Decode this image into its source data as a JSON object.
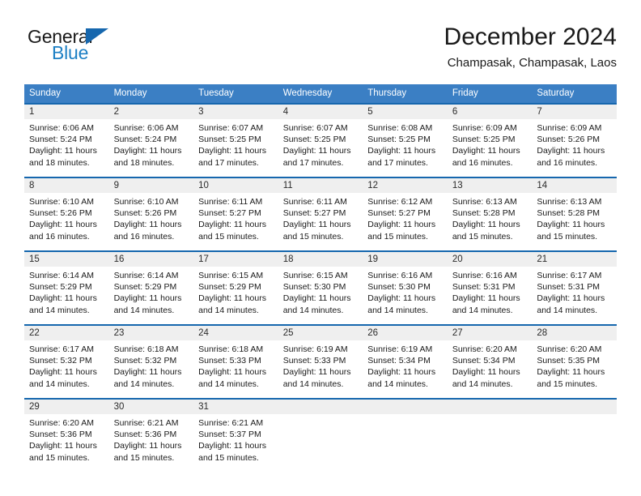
{
  "brand": {
    "name_part1": "General",
    "name_part2": "Blue",
    "triangle_color": "#1667ae",
    "blue_color": "#1c7fc4"
  },
  "header": {
    "month_title": "December 2024",
    "location": "Champasak, Champasak, Laos"
  },
  "theme": {
    "header_blue": "#3b7fc4",
    "row_border_blue": "#1667ae",
    "daynum_band": "#efefef"
  },
  "weekday_headers": [
    "Sunday",
    "Monday",
    "Tuesday",
    "Wednesday",
    "Thursday",
    "Friday",
    "Saturday"
  ],
  "weeks": [
    [
      {
        "day": "1",
        "sunrise": "Sunrise: 6:06 AM",
        "sunset": "Sunset: 5:24 PM",
        "daylight1": "Daylight: 11 hours",
        "daylight2": "and 18 minutes."
      },
      {
        "day": "2",
        "sunrise": "Sunrise: 6:06 AM",
        "sunset": "Sunset: 5:24 PM",
        "daylight1": "Daylight: 11 hours",
        "daylight2": "and 18 minutes."
      },
      {
        "day": "3",
        "sunrise": "Sunrise: 6:07 AM",
        "sunset": "Sunset: 5:25 PM",
        "daylight1": "Daylight: 11 hours",
        "daylight2": "and 17 minutes."
      },
      {
        "day": "4",
        "sunrise": "Sunrise: 6:07 AM",
        "sunset": "Sunset: 5:25 PM",
        "daylight1": "Daylight: 11 hours",
        "daylight2": "and 17 minutes."
      },
      {
        "day": "5",
        "sunrise": "Sunrise: 6:08 AM",
        "sunset": "Sunset: 5:25 PM",
        "daylight1": "Daylight: 11 hours",
        "daylight2": "and 17 minutes."
      },
      {
        "day": "6",
        "sunrise": "Sunrise: 6:09 AM",
        "sunset": "Sunset: 5:25 PM",
        "daylight1": "Daylight: 11 hours",
        "daylight2": "and 16 minutes."
      },
      {
        "day": "7",
        "sunrise": "Sunrise: 6:09 AM",
        "sunset": "Sunset: 5:26 PM",
        "daylight1": "Daylight: 11 hours",
        "daylight2": "and 16 minutes."
      }
    ],
    [
      {
        "day": "8",
        "sunrise": "Sunrise: 6:10 AM",
        "sunset": "Sunset: 5:26 PM",
        "daylight1": "Daylight: 11 hours",
        "daylight2": "and 16 minutes."
      },
      {
        "day": "9",
        "sunrise": "Sunrise: 6:10 AM",
        "sunset": "Sunset: 5:26 PM",
        "daylight1": "Daylight: 11 hours",
        "daylight2": "and 16 minutes."
      },
      {
        "day": "10",
        "sunrise": "Sunrise: 6:11 AM",
        "sunset": "Sunset: 5:27 PM",
        "daylight1": "Daylight: 11 hours",
        "daylight2": "and 15 minutes."
      },
      {
        "day": "11",
        "sunrise": "Sunrise: 6:11 AM",
        "sunset": "Sunset: 5:27 PM",
        "daylight1": "Daylight: 11 hours",
        "daylight2": "and 15 minutes."
      },
      {
        "day": "12",
        "sunrise": "Sunrise: 6:12 AM",
        "sunset": "Sunset: 5:27 PM",
        "daylight1": "Daylight: 11 hours",
        "daylight2": "and 15 minutes."
      },
      {
        "day": "13",
        "sunrise": "Sunrise: 6:13 AM",
        "sunset": "Sunset: 5:28 PM",
        "daylight1": "Daylight: 11 hours",
        "daylight2": "and 15 minutes."
      },
      {
        "day": "14",
        "sunrise": "Sunrise: 6:13 AM",
        "sunset": "Sunset: 5:28 PM",
        "daylight1": "Daylight: 11 hours",
        "daylight2": "and 15 minutes."
      }
    ],
    [
      {
        "day": "15",
        "sunrise": "Sunrise: 6:14 AM",
        "sunset": "Sunset: 5:29 PM",
        "daylight1": "Daylight: 11 hours",
        "daylight2": "and 14 minutes."
      },
      {
        "day": "16",
        "sunrise": "Sunrise: 6:14 AM",
        "sunset": "Sunset: 5:29 PM",
        "daylight1": "Daylight: 11 hours",
        "daylight2": "and 14 minutes."
      },
      {
        "day": "17",
        "sunrise": "Sunrise: 6:15 AM",
        "sunset": "Sunset: 5:29 PM",
        "daylight1": "Daylight: 11 hours",
        "daylight2": "and 14 minutes."
      },
      {
        "day": "18",
        "sunrise": "Sunrise: 6:15 AM",
        "sunset": "Sunset: 5:30 PM",
        "daylight1": "Daylight: 11 hours",
        "daylight2": "and 14 minutes."
      },
      {
        "day": "19",
        "sunrise": "Sunrise: 6:16 AM",
        "sunset": "Sunset: 5:30 PM",
        "daylight1": "Daylight: 11 hours",
        "daylight2": "and 14 minutes."
      },
      {
        "day": "20",
        "sunrise": "Sunrise: 6:16 AM",
        "sunset": "Sunset: 5:31 PM",
        "daylight1": "Daylight: 11 hours",
        "daylight2": "and 14 minutes."
      },
      {
        "day": "21",
        "sunrise": "Sunrise: 6:17 AM",
        "sunset": "Sunset: 5:31 PM",
        "daylight1": "Daylight: 11 hours",
        "daylight2": "and 14 minutes."
      }
    ],
    [
      {
        "day": "22",
        "sunrise": "Sunrise: 6:17 AM",
        "sunset": "Sunset: 5:32 PM",
        "daylight1": "Daylight: 11 hours",
        "daylight2": "and 14 minutes."
      },
      {
        "day": "23",
        "sunrise": "Sunrise: 6:18 AM",
        "sunset": "Sunset: 5:32 PM",
        "daylight1": "Daylight: 11 hours",
        "daylight2": "and 14 minutes."
      },
      {
        "day": "24",
        "sunrise": "Sunrise: 6:18 AM",
        "sunset": "Sunset: 5:33 PM",
        "daylight1": "Daylight: 11 hours",
        "daylight2": "and 14 minutes."
      },
      {
        "day": "25",
        "sunrise": "Sunrise: 6:19 AM",
        "sunset": "Sunset: 5:33 PM",
        "daylight1": "Daylight: 11 hours",
        "daylight2": "and 14 minutes."
      },
      {
        "day": "26",
        "sunrise": "Sunrise: 6:19 AM",
        "sunset": "Sunset: 5:34 PM",
        "daylight1": "Daylight: 11 hours",
        "daylight2": "and 14 minutes."
      },
      {
        "day": "27",
        "sunrise": "Sunrise: 6:20 AM",
        "sunset": "Sunset: 5:34 PM",
        "daylight1": "Daylight: 11 hours",
        "daylight2": "and 14 minutes."
      },
      {
        "day": "28",
        "sunrise": "Sunrise: 6:20 AM",
        "sunset": "Sunset: 5:35 PM",
        "daylight1": "Daylight: 11 hours",
        "daylight2": "and 15 minutes."
      }
    ],
    [
      {
        "day": "29",
        "sunrise": "Sunrise: 6:20 AM",
        "sunset": "Sunset: 5:36 PM",
        "daylight1": "Daylight: 11 hours",
        "daylight2": "and 15 minutes."
      },
      {
        "day": "30",
        "sunrise": "Sunrise: 6:21 AM",
        "sunset": "Sunset: 5:36 PM",
        "daylight1": "Daylight: 11 hours",
        "daylight2": "and 15 minutes."
      },
      {
        "day": "31",
        "sunrise": "Sunrise: 6:21 AM",
        "sunset": "Sunset: 5:37 PM",
        "daylight1": "Daylight: 11 hours",
        "daylight2": "and 15 minutes."
      },
      {
        "day": "",
        "sunrise": "",
        "sunset": "",
        "daylight1": "",
        "daylight2": ""
      },
      {
        "day": "",
        "sunrise": "",
        "sunset": "",
        "daylight1": "",
        "daylight2": ""
      },
      {
        "day": "",
        "sunrise": "",
        "sunset": "",
        "daylight1": "",
        "daylight2": ""
      },
      {
        "day": "",
        "sunrise": "",
        "sunset": "",
        "daylight1": "",
        "daylight2": ""
      }
    ]
  ]
}
